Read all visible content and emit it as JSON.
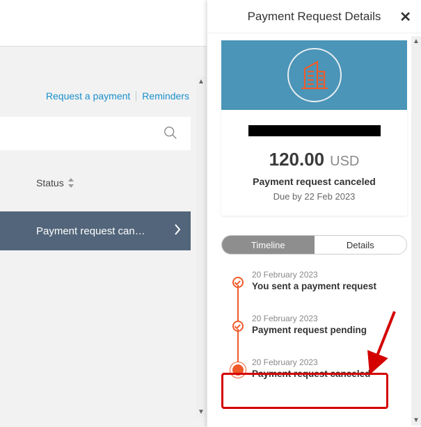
{
  "back": {
    "link_request": "Request a payment",
    "link_reminders": "Reminders",
    "status_header": "Status",
    "row_text": "Payment request can…"
  },
  "panel": {
    "title": "Payment Request Details",
    "amount": "120.00",
    "currency": "USD",
    "status": "Payment request canceled",
    "due": "Due by 22 Feb 2023"
  },
  "tabs": {
    "timeline": "Timeline",
    "details": "Details"
  },
  "timeline": [
    {
      "date": "20 February 2023",
      "title": "You sent a payment request",
      "kind": "ring"
    },
    {
      "date": "20 February 2023",
      "title": "Payment request pending",
      "kind": "ring"
    },
    {
      "date": "20 February 2023",
      "title": "Payment request canceled",
      "kind": "fill"
    }
  ]
}
